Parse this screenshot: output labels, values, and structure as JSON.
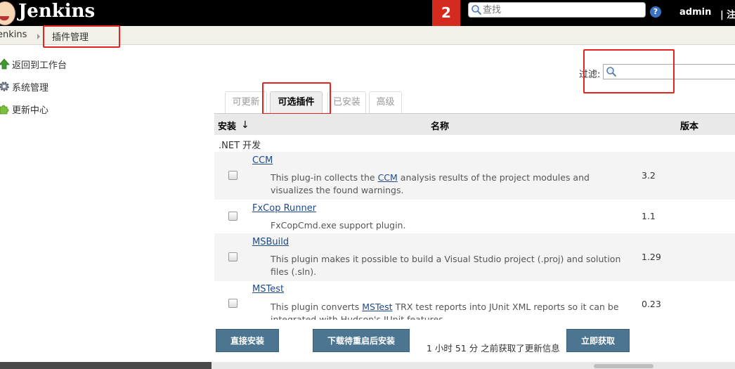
{
  "header": {
    "logo_text": "Jenkins",
    "badge": "2",
    "search_placeholder": "查找",
    "help": "?",
    "user": "admin",
    "logout": "| 注"
  },
  "breadcrumb": {
    "home": "enkins",
    "current": "插件管理"
  },
  "sidebar": {
    "items": [
      {
        "label": "返回到工作台",
        "icon": "up-arrow-icon"
      },
      {
        "label": "系统管理",
        "icon": "gear-icon"
      },
      {
        "label": "更新中心",
        "icon": "puzzle-icon"
      }
    ]
  },
  "filter": {
    "label": "过滤:"
  },
  "tabs": [
    {
      "label": "可更新",
      "active": false
    },
    {
      "label": "可选插件",
      "active": true
    },
    {
      "label": "已安装",
      "active": false
    },
    {
      "label": "高级",
      "active": false
    }
  ],
  "table": {
    "headers": {
      "install": "安装",
      "sort": "↓",
      "name": "名称",
      "version": "版本"
    },
    "category": ".NET 开发",
    "rows": [
      {
        "name": "CCM",
        "desc_pre": "This plug-in collects the ",
        "desc_link": "CCM",
        "desc_post": " analysis results of the project modules and visualizes the found warnings.",
        "version": "3.2"
      },
      {
        "name": "FxCop Runner",
        "desc_pre": "FxCopCmd.exe support plugin.",
        "desc_link": "",
        "desc_post": "",
        "version": "1.1"
      },
      {
        "name": "MSBuild",
        "desc_pre": "This plugin makes it possible to build a Visual Studio project (.proj) and solution files (.sln).",
        "desc_link": "",
        "desc_post": "",
        "version": "1.29"
      },
      {
        "name": "MSTest",
        "desc_pre": "This plugin converts ",
        "desc_link": "MSTest",
        "desc_post": " TRX test reports into JUnit XML reports so it can be integrated with Hudson's JUnit features.",
        "version": "0.23"
      }
    ]
  },
  "footer": {
    "install_now": "直接安装",
    "download_restart": "下载待重启后安装",
    "update_info": "1 小时 51 分 之前获取了更新信息",
    "fetch_now": "立即获取"
  },
  "colors": {
    "header_bg": "#000000",
    "badge_bg": "#d52b1e",
    "button_bg": "#4b7591",
    "annotation_red": "#e8231f",
    "link": "#204a87"
  }
}
